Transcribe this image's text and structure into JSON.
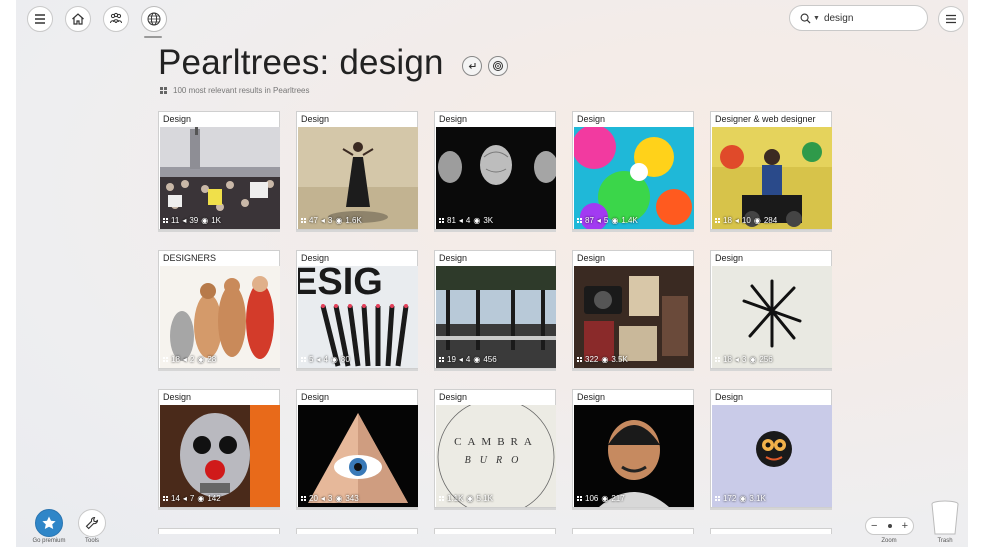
{
  "header": {
    "nav": [
      {
        "name": "menu-icon"
      },
      {
        "name": "home-icon"
      },
      {
        "name": "team-icon"
      },
      {
        "name": "globe-icon"
      }
    ],
    "search_value": "design",
    "right_menu_icon": "hamburger-icon"
  },
  "page": {
    "title": "Pearltrees: design",
    "subtitle": "100 most relevant results in Pearltrees"
  },
  "tiles": [
    {
      "label": "Design",
      "s1": "11",
      "s2": "39",
      "s3": "1K"
    },
    {
      "label": "Design",
      "s1": "47",
      "s2": "3",
      "s3": "1.6K"
    },
    {
      "label": "Design",
      "s1": "81",
      "s2": "4",
      "s3": "3K"
    },
    {
      "label": "Design",
      "s1": "87",
      "s2": "5",
      "s3": "1.4K"
    },
    {
      "label": "Designer & web designer",
      "s1": "18",
      "s2": "10",
      "s3": "284"
    },
    {
      "label": "DESIGNERS",
      "s1": "18",
      "s2": "2",
      "s3": "28"
    },
    {
      "label": "Design",
      "s1": "5",
      "s2": "4",
      "s3": "80"
    },
    {
      "label": "Design",
      "s1": "19",
      "s2": "4",
      "s3": "456"
    },
    {
      "label": "Design",
      "s1": "322",
      "s2": "",
      "s3": "3.5K"
    },
    {
      "label": "Design",
      "s1": "18",
      "s2": "3",
      "s3": "256"
    },
    {
      "label": "Design",
      "s1": "14",
      "s2": "7",
      "s3": "142"
    },
    {
      "label": "Design",
      "s1": "20",
      "s2": "3",
      "s3": "343"
    },
    {
      "label": "Design",
      "s1": "1.1K",
      "s2": "",
      "s3": "5.1K"
    },
    {
      "label": "Design",
      "s1": "106",
      "s2": "",
      "s3": "217"
    },
    {
      "label": "Design",
      "s1": "172",
      "s2": "",
      "s3": "3.1K"
    }
  ],
  "tile_art": {
    "t3_word": "CAMBRA",
    "t3_sub": "BURO",
    "t1_word": "ESIG"
  },
  "bottom": {
    "premium_label": "Go premium",
    "tools_label": "Tools",
    "zoom_label": "Zoom",
    "zoom_minus": "−",
    "zoom_plus": "+",
    "trash_label": "Trash"
  },
  "colors": {
    "premium_blue": "#2f86c8",
    "border": "#c9c9c9"
  }
}
